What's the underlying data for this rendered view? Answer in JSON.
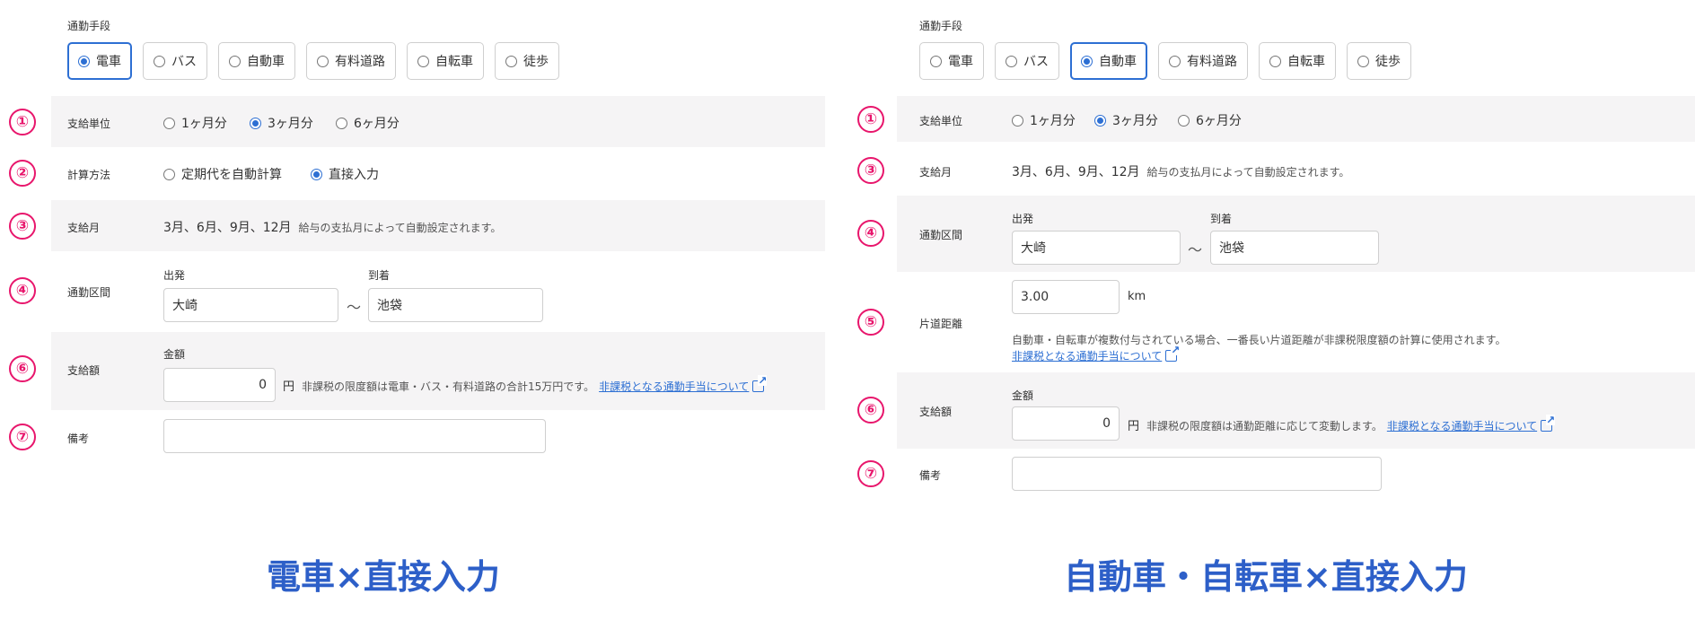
{
  "left": {
    "section_label": "通勤手段",
    "modes": [
      {
        "label": "電車",
        "selected": true
      },
      {
        "label": "バス",
        "selected": false
      },
      {
        "label": "自動車",
        "selected": false
      },
      {
        "label": "有料道路",
        "selected": false
      },
      {
        "label": "自転車",
        "selected": false
      },
      {
        "label": "徒歩",
        "selected": false
      }
    ],
    "pay_unit": {
      "badge": "①",
      "label": "支給単位",
      "options": [
        {
          "label": "1ヶ月分",
          "selected": false
        },
        {
          "label": "3ヶ月分",
          "selected": true
        },
        {
          "label": "6ヶ月分",
          "selected": false
        }
      ]
    },
    "calc_method": {
      "badge": "②",
      "label": "計算方法",
      "options": [
        {
          "label": "定期代を自動計算",
          "selected": false
        },
        {
          "label": "直接入力",
          "selected": true
        }
      ]
    },
    "pay_month": {
      "badge": "③",
      "label": "支給月",
      "value": "3月、6月、9月、12月",
      "note": "給与の支払月によって自動設定されます。"
    },
    "route": {
      "badge": "④",
      "label": "通勤区間",
      "from_label": "出発",
      "from_value": "大崎",
      "tilde": "〜",
      "to_label": "到着",
      "to_value": "池袋"
    },
    "amount": {
      "badge": "⑥",
      "label": "支給額",
      "field_label": "金額",
      "value": "0",
      "unit": "円",
      "note": "非課税の限度額は電車・バス・有料道路の合計15万円です。",
      "link": "非課税となる通勤手当について"
    },
    "remarks": {
      "badge": "⑦",
      "label": "備考",
      "value": ""
    },
    "caption": "電車×直接入力"
  },
  "right": {
    "section_label": "通勤手段",
    "modes": [
      {
        "label": "電車",
        "selected": false
      },
      {
        "label": "バス",
        "selected": false
      },
      {
        "label": "自動車",
        "selected": true
      },
      {
        "label": "有料道路",
        "selected": false
      },
      {
        "label": "自転車",
        "selected": false
      },
      {
        "label": "徒歩",
        "selected": false
      }
    ],
    "pay_unit": {
      "badge": "①",
      "label": "支給単位",
      "options": [
        {
          "label": "1ヶ月分",
          "selected": false
        },
        {
          "label": "3ヶ月分",
          "selected": true
        },
        {
          "label": "6ヶ月分",
          "selected": false
        }
      ]
    },
    "pay_month": {
      "badge": "③",
      "label": "支給月",
      "value": "3月、6月、9月、12月",
      "note": "給与の支払月によって自動設定されます。"
    },
    "route": {
      "badge": "④",
      "label": "通勤区間",
      "from_label": "出発",
      "from_value": "大崎",
      "tilde": "〜",
      "to_label": "到着",
      "to_value": "池袋"
    },
    "distance": {
      "badge": "⑤",
      "label": "片道距離",
      "value": "3.00",
      "unit": "km",
      "note": "自動車・自転車が複数付与されている場合、一番長い片道距離が非課税限度額の計算に使用されます。",
      "link": "非課税となる通勤手当について"
    },
    "amount": {
      "badge": "⑥",
      "label": "支給額",
      "field_label": "金額",
      "value": "0",
      "unit": "円",
      "note": "非課税の限度額は通勤距離に応じて変動します。",
      "link": "非課税となる通勤手当について"
    },
    "remarks": {
      "badge": "⑦",
      "label": "備考",
      "value": ""
    },
    "caption": "自動車・自転車×直接入力"
  },
  "colors": {
    "accent": "#2d6fd3",
    "badge": "#e8166c",
    "caption": "#2d5fc8",
    "row_shade": "#f5f4f5"
  }
}
